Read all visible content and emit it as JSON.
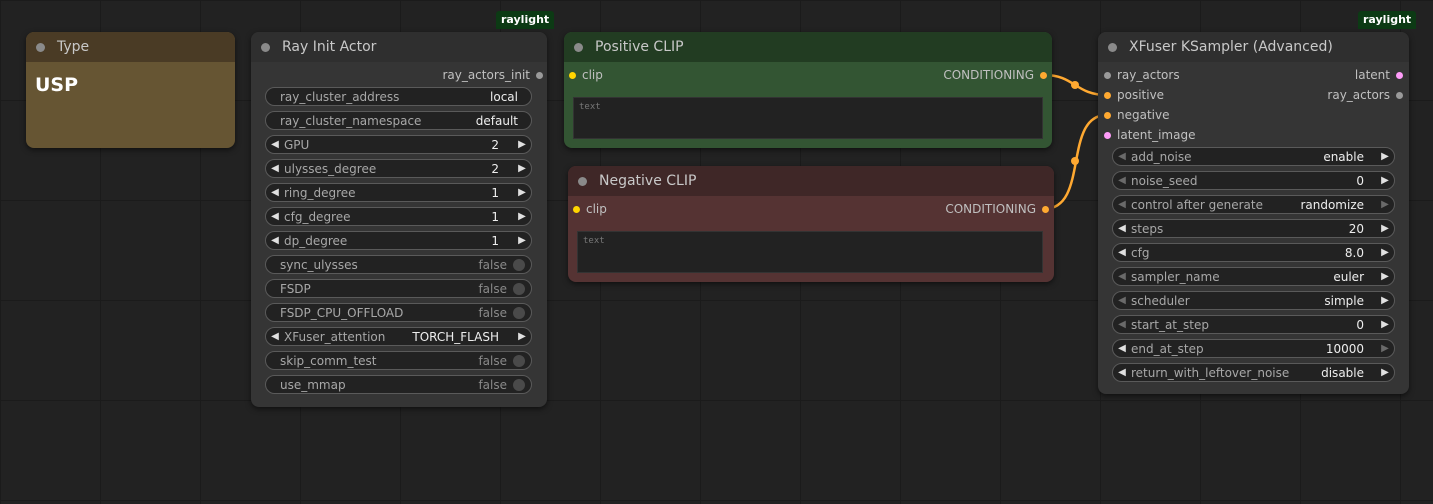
{
  "colors": {
    "canvas": "#222222",
    "node_body": "#353535",
    "type_node": "#665533",
    "positive_node": "#335533",
    "negative_node": "#553333",
    "badge_bg": "#0c3a14",
    "link_conditioning": "#ffa931",
    "slot_clip": "#ffd500",
    "slot_latent": "#ff9cf9",
    "slot_generic": "#9a9a9a"
  },
  "type_node": {
    "title": "Type",
    "content": "USP"
  },
  "ray_init": {
    "badge": "raylight",
    "title": "Ray Init Actor",
    "output": "ray_actors_init",
    "widgets": [
      {
        "name": "ray_cluster_address",
        "value": "local",
        "kind": "text"
      },
      {
        "name": "ray_cluster_namespace",
        "value": "default",
        "kind": "text"
      },
      {
        "name": "GPU",
        "value": "2",
        "kind": "number"
      },
      {
        "name": "ulysses_degree",
        "value": "2",
        "kind": "number"
      },
      {
        "name": "ring_degree",
        "value": "1",
        "kind": "number"
      },
      {
        "name": "cfg_degree",
        "value": "1",
        "kind": "number"
      },
      {
        "name": "dp_degree",
        "value": "1",
        "kind": "number"
      },
      {
        "name": "sync_ulysses",
        "value": "false",
        "kind": "toggle"
      },
      {
        "name": "FSDP",
        "value": "false",
        "kind": "toggle"
      },
      {
        "name": "FSDP_CPU_OFFLOAD",
        "value": "false",
        "kind": "toggle"
      },
      {
        "name": "XFuser_attention",
        "value": "TORCH_FLASH",
        "kind": "combo"
      },
      {
        "name": "skip_comm_test",
        "value": "false",
        "kind": "toggle"
      },
      {
        "name": "use_mmap",
        "value": "false",
        "kind": "toggle"
      }
    ]
  },
  "positive": {
    "title": "Positive CLIP",
    "input": "clip",
    "output": "CONDITIONING",
    "text_placeholder": "text"
  },
  "negative": {
    "title": "Negative CLIP",
    "input": "clip",
    "output": "CONDITIONING",
    "text_placeholder": "text"
  },
  "ksampler": {
    "badge": "raylight",
    "title": "XFuser KSampler (Advanced)",
    "inputs": [
      "ray_actors",
      "positive",
      "negative",
      "latent_image"
    ],
    "outputs": [
      "latent",
      "ray_actors"
    ],
    "widgets": [
      {
        "name": "add_noise",
        "value": "enable",
        "left_dim": true,
        "right_dim": false
      },
      {
        "name": "noise_seed",
        "value": "0",
        "left_dim": true,
        "right_dim": false
      },
      {
        "name": "control after generate",
        "value": "randomize",
        "left_dim": true,
        "right_dim": true
      },
      {
        "name": "steps",
        "value": "20",
        "left_dim": false,
        "right_dim": false
      },
      {
        "name": "cfg",
        "value": "8.0",
        "left_dim": false,
        "right_dim": false
      },
      {
        "name": "sampler_name",
        "value": "euler",
        "left_dim": true,
        "right_dim": false
      },
      {
        "name": "scheduler",
        "value": "simple",
        "left_dim": true,
        "right_dim": false
      },
      {
        "name": "start_at_step",
        "value": "0",
        "left_dim": true,
        "right_dim": false
      },
      {
        "name": "end_at_step",
        "value": "10000",
        "left_dim": false,
        "right_dim": true
      },
      {
        "name": "return_with_leftover_noise",
        "value": "disable",
        "left_dim": false,
        "right_dim": false
      }
    ]
  }
}
